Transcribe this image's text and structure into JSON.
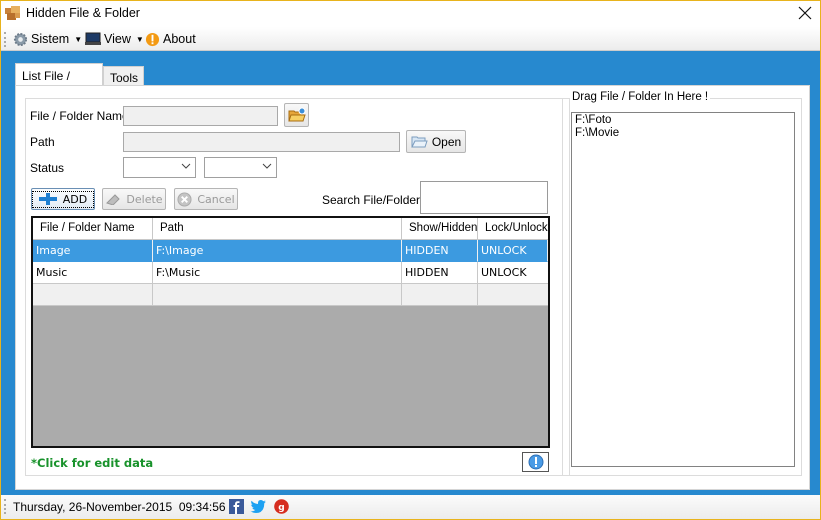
{
  "window": {
    "title": "Hidden File & Folder",
    "close_label": "✕"
  },
  "menu": {
    "items": [
      {
        "label": "Sistem",
        "icon": "gear-icon",
        "has_dropdown": true
      },
      {
        "label": "View",
        "icon": "monitor-icon",
        "has_dropdown": true
      },
      {
        "label": "About",
        "icon": "info-warning-icon",
        "has_dropdown": false
      }
    ],
    "caret": "▼"
  },
  "tabs": [
    {
      "label": "List File / Folder",
      "active": true
    },
    {
      "label": "Tools",
      "active": false
    }
  ],
  "form": {
    "name_label": "File / Folder Name",
    "name_value": "",
    "path_label": "Path",
    "path_value": "",
    "status_label": "Status",
    "status_show_value": "",
    "status_lock_value": "",
    "open_label": "Open",
    "search_label": "Search File/Folder",
    "search_value": ""
  },
  "buttons": {
    "add": "ADD",
    "delete": "Delete",
    "cancel": "Cancel"
  },
  "grid": {
    "columns": [
      "File / Folder Name",
      "Path",
      "Show/Hidden",
      "Lock/Unlock"
    ],
    "rows": [
      {
        "name": "Image",
        "path": "F:\\Image",
        "show": "HIDDEN",
        "lock": "UNLOCK",
        "selected": true
      },
      {
        "name": "Music",
        "path": "F:\\Music",
        "show": "HIDDEN",
        "lock": "UNLOCK",
        "selected": false
      },
      {
        "name": "",
        "path": "",
        "show": "",
        "lock": "",
        "selected": false
      }
    ]
  },
  "hint": "*Click for edit data",
  "drop": {
    "title": "Drag File / Folder In Here !",
    "items": [
      "F:\\Foto",
      "F:\\Movie"
    ]
  },
  "status": {
    "datetime": "Thursday, 26-November-2015  09:34:56",
    "social": [
      "facebook-icon",
      "twitter-icon",
      "google-plus-icon"
    ]
  },
  "colors": {
    "accent": "#2789cf",
    "selection": "#3c9ae0",
    "hint": "#18922b",
    "frame": "#e8b31c"
  }
}
